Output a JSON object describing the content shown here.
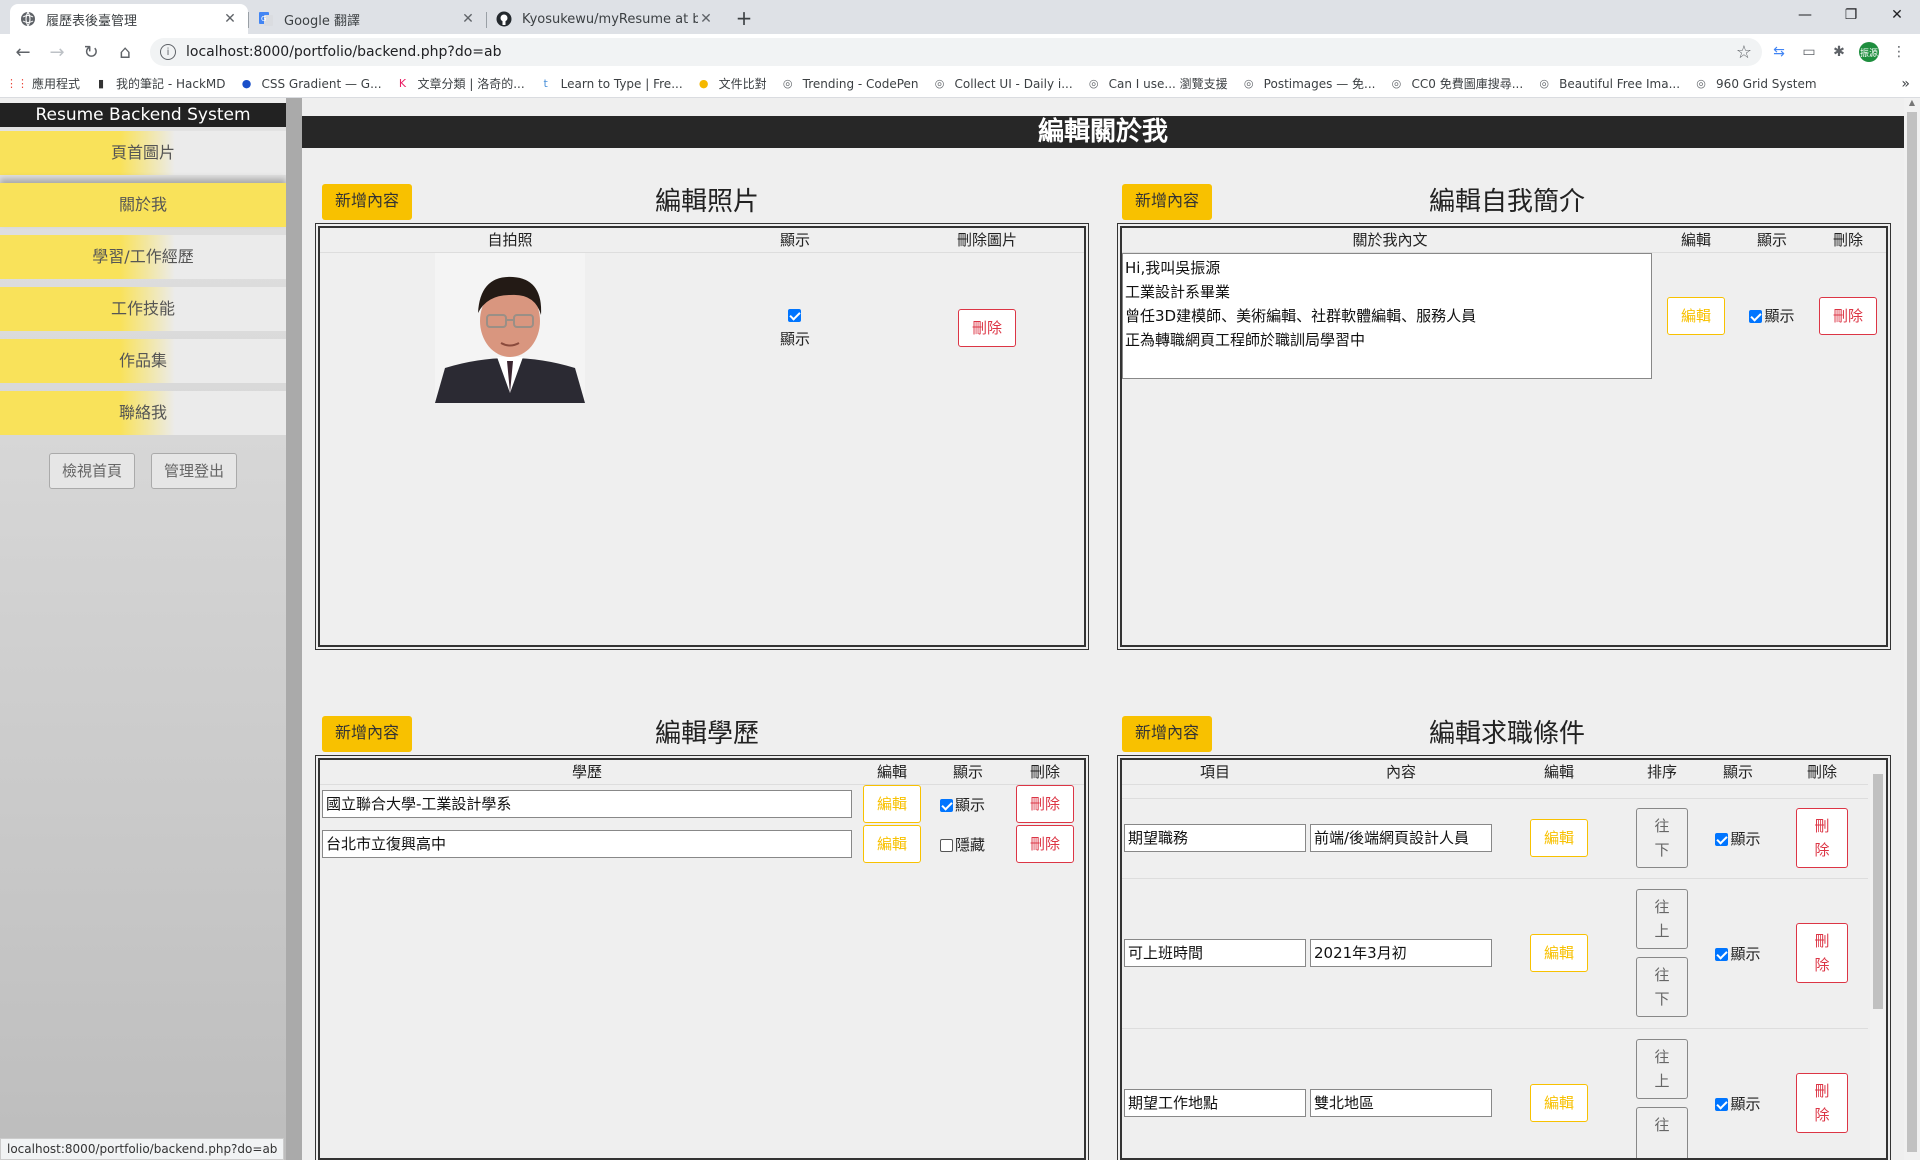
{
  "browser": {
    "tabs": [
      {
        "title": "履歷表後臺管理",
        "active": true,
        "icon": "globe-icon"
      },
      {
        "title": "Google 翻譯",
        "active": false,
        "icon": "google-translate-icon"
      },
      {
        "title": "Kyosukewu/myResume at back",
        "active": false,
        "icon": "github-icon"
      }
    ],
    "url": "localhost:8000/portfolio/backend.php?do=ab",
    "profile_initials": "振源",
    "bookmarks": [
      {
        "label": "應用程式",
        "icon": "apps-grid-icon"
      },
      {
        "label": "我的筆記 - HackMD",
        "icon": "hackmd-icon"
      },
      {
        "label": "CSS Gradient — G...",
        "icon": "css-gradient-icon"
      },
      {
        "label": "文章分類 | 洛奇的...",
        "icon": "k-icon"
      },
      {
        "label": "Learn to Type | Fre...",
        "icon": "typing-icon"
      },
      {
        "label": "文件比對",
        "icon": "lemon-icon"
      },
      {
        "label": "Trending - CodePen",
        "icon": "globe-icon"
      },
      {
        "label": "Collect UI - Daily i...",
        "icon": "globe-icon"
      },
      {
        "label": "Can I use... 瀏覽支援",
        "icon": "globe-icon"
      },
      {
        "label": "Postimages — 免...",
        "icon": "globe-icon"
      },
      {
        "label": "CC0 免費圖庫搜尋...",
        "icon": "globe-icon"
      },
      {
        "label": "Beautiful Free Ima...",
        "icon": "globe-icon"
      },
      {
        "label": "960 Grid System",
        "icon": "globe-icon"
      }
    ],
    "status_url": "localhost:8000/portfolio/backend.php?do=ab"
  },
  "sidebar": {
    "title": "Resume Backend System",
    "items": [
      {
        "label": "頁首圖片",
        "active": false
      },
      {
        "label": "關於我",
        "active": true
      },
      {
        "label": "學習/工作經歷",
        "active": false
      },
      {
        "label": "工作技能",
        "active": false
      },
      {
        "label": "作品集",
        "active": false
      },
      {
        "label": "聯絡我",
        "active": false
      }
    ],
    "view_home": "檢視首頁",
    "logout": "管理登出"
  },
  "main": {
    "title": "編輯關於我",
    "photo": {
      "add": "新增內容",
      "title": "編輯照片",
      "headers": [
        "自拍照",
        "顯示",
        "刪除圖片"
      ],
      "show_label": "顯示",
      "show_checked": true,
      "delete": "刪除"
    },
    "intro": {
      "add": "新增內容",
      "title": "編輯自我簡介",
      "headers": [
        "關於我內文",
        "編輯",
        "顯示",
        "刪除"
      ],
      "text": "Hi,我叫吳振源\n工業設計系畢業\n曾任3D建模師、美術編輯、社群軟體編輯、服務人員\n正為轉職網頁工程師於職訓局學習中",
      "edit": "編輯",
      "show_label": "顯示",
      "show_checked": true,
      "delete": "刪除"
    },
    "education": {
      "add": "新增內容",
      "title": "編輯學歷",
      "headers": [
        "學歷",
        "編輯",
        "顯示",
        "刪除"
      ],
      "rows": [
        {
          "school": "國立聯合大學-工業設計學系",
          "edit": "編輯",
          "state": "顯示",
          "checked": true,
          "delete": "刪除"
        },
        {
          "school": "台北市立復興高中",
          "edit": "編輯",
          "state": "隱藏",
          "checked": false,
          "delete": "刪除"
        }
      ]
    },
    "job": {
      "add": "新增內容",
      "title": "編輯求職條件",
      "headers": [
        "項目",
        "內容",
        "編輯",
        "排序",
        "顯示",
        "刪除"
      ],
      "rows": [
        {
          "item": "期望職務",
          "content": "前端/後端網頁設計人員",
          "edit": "編輯",
          "sort": [
            "往下"
          ],
          "state": "顯示",
          "delete": "刪除"
        },
        {
          "item": "可上班時間",
          "content": "2021年3月初",
          "edit": "編輯",
          "sort": [
            "往上",
            "往下"
          ],
          "state": "顯示",
          "delete": "刪除"
        },
        {
          "item": "期望工作地點",
          "content": "雙北地區",
          "edit": "編輯",
          "sort": [
            "往上",
            "往"
          ],
          "state": "顯示",
          "delete": "刪除"
        }
      ]
    }
  }
}
